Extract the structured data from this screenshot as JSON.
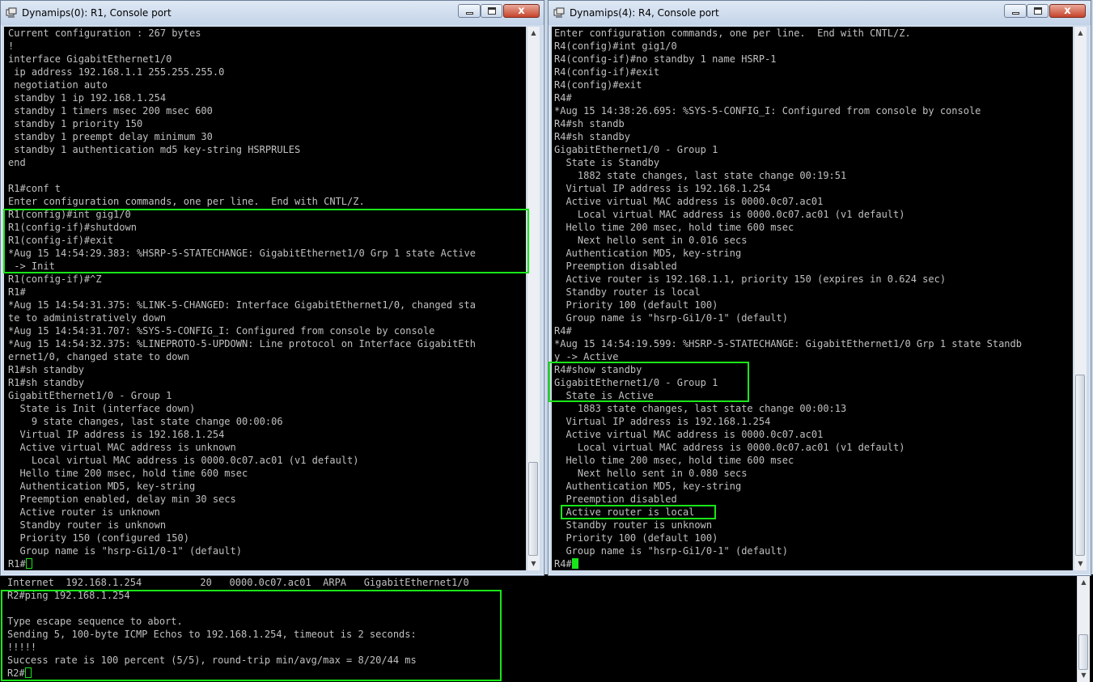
{
  "window_r1": {
    "title": "Dynamips(0): R1, Console port",
    "lines": [
      "Current configuration : 267 bytes",
      "!",
      "interface GigabitEthernet1/0",
      " ip address 192.168.1.1 255.255.255.0",
      " negotiation auto",
      " standby 1 ip 192.168.1.254",
      " standby 1 timers msec 200 msec 600",
      " standby 1 priority 150",
      " standby 1 preempt delay minimum 30",
      " standby 1 authentication md5 key-string HSRPRULES",
      "end",
      "",
      "R1#conf t",
      "Enter configuration commands, one per line.  End with CNTL/Z.",
      "R1(config)#int gig1/0",
      "R1(config-if)#shutdown",
      "R1(config-if)#exit",
      "*Aug 15 14:54:29.383: %HSRP-5-STATECHANGE: GigabitEthernet1/0 Grp 1 state Active",
      " -> Init",
      "R1(config-if)#^Z",
      "R1#",
      "*Aug 15 14:54:31.375: %LINK-5-CHANGED: Interface GigabitEthernet1/0, changed sta",
      "te to administratively down",
      "*Aug 15 14:54:31.707: %SYS-5-CONFIG_I: Configured from console by console",
      "*Aug 15 14:54:32.375: %LINEPROTO-5-UPDOWN: Line protocol on Interface GigabitEth",
      "ernet1/0, changed state to down",
      "R1#sh standby",
      "R1#sh standby",
      "GigabitEthernet1/0 - Group 1",
      "  State is Init (interface down)",
      "    9 state changes, last state change 00:00:06",
      "  Virtual IP address is 192.168.1.254",
      "  Active virtual MAC address is unknown",
      "    Local virtual MAC address is 0000.0c07.ac01 (v1 default)",
      "  Hello time 200 msec, hold time 600 msec",
      "  Authentication MD5, key-string",
      "  Preemption enabled, delay min 30 secs",
      "  Active router is unknown",
      "  Standby router is unknown",
      "  Priority 150 (configured 150)",
      "  Group name is \"hsrp-Gi1/0-1\" (default)"
    ],
    "prompt": "R1#"
  },
  "window_r4": {
    "title": "Dynamips(4): R4, Console port",
    "lines": [
      "Enter configuration commands, one per line.  End with CNTL/Z.",
      "R4(config)#int gig1/0",
      "R4(config-if)#no standby 1 name HSRP-1",
      "R4(config-if)#exit",
      "R4(config)#exit",
      "R4#",
      "*Aug 15 14:38:26.695: %SYS-5-CONFIG_I: Configured from console by console",
      "R4#sh standb",
      "R4#sh standby",
      "GigabitEthernet1/0 - Group 1",
      "  State is Standby",
      "    1882 state changes, last state change 00:19:51",
      "  Virtual IP address is 192.168.1.254",
      "  Active virtual MAC address is 0000.0c07.ac01",
      "    Local virtual MAC address is 0000.0c07.ac01 (v1 default)",
      "  Hello time 200 msec, hold time 600 msec",
      "    Next hello sent in 0.016 secs",
      "  Authentication MD5, key-string",
      "  Preemption disabled",
      "  Active router is 192.168.1.1, priority 150 (expires in 0.624 sec)",
      "  Standby router is local",
      "  Priority 100 (default 100)",
      "  Group name is \"hsrp-Gi1/0-1\" (default)",
      "R4#",
      "*Aug 15 14:54:19.599: %HSRP-5-STATECHANGE: GigabitEthernet1/0 Grp 1 state Standb",
      "y -> Active",
      "R4#show standby",
      "GigabitEthernet1/0 - Group 1",
      "  State is Active",
      "    1883 state changes, last state change 00:00:13",
      "  Virtual IP address is 192.168.1.254",
      "  Active virtual MAC address is 0000.0c07.ac01",
      "    Local virtual MAC address is 0000.0c07.ac01 (v1 default)",
      "  Hello time 200 msec, hold time 600 msec",
      "    Next hello sent in 0.080 secs",
      "  Authentication MD5, key-string",
      "  Preemption disabled",
      "  Active router is local",
      "  Standby router is unknown",
      "  Priority 100 (default 100)",
      "  Group name is \"hsrp-Gi1/0-1\" (default)"
    ],
    "prompt": "R4#"
  },
  "window_r2": {
    "lines": [
      "Internet  192.168.1.254          20   0000.0c07.ac01  ARPA   GigabitEthernet1/0",
      "R2#ping 192.168.1.254",
      "",
      "Type escape sequence to abort.",
      "Sending 5, 100-byte ICMP Echos to 192.168.1.254, timeout is 2 seconds:",
      "!!!!!",
      "Success rate is 100 percent (5/5), round-trip min/avg/max = 8/20/44 ms"
    ],
    "prompt": "R2#"
  },
  "controls": {
    "close_glyph": "x",
    "scroll_up": "▲",
    "scroll_down": "▼"
  },
  "colors": {
    "terminal_bg": "#000000",
    "terminal_text": "#c0c0c0",
    "highlight": "#19e619"
  },
  "icons": [
    "console-window-icon",
    "minimize-icon",
    "maximize-icon",
    "close-icon"
  ]
}
